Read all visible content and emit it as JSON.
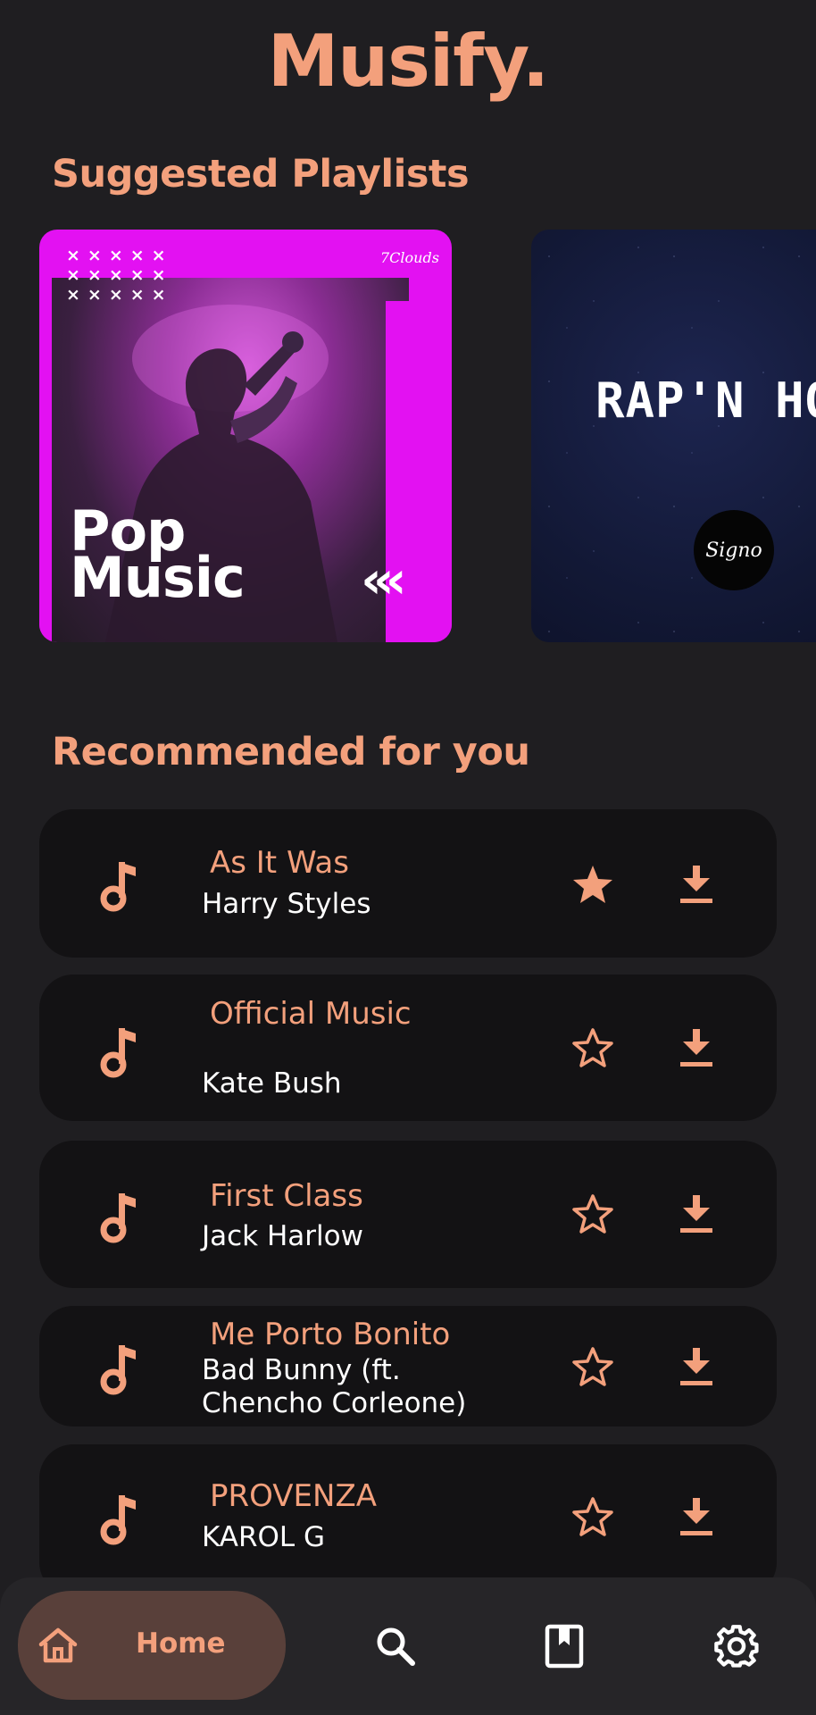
{
  "app": {
    "title": "Musify."
  },
  "sections": {
    "suggested": "Suggested Playlists",
    "recommended": "Recommended for you"
  },
  "playlists": [
    {
      "title_line1": "Pop",
      "title_line2": "Music",
      "logo": "7Clouds",
      "decor_dots": "×××××",
      "decor_arrows": "‹‹‹",
      "accent": "#e311f2"
    },
    {
      "title": "RAP'N HOU",
      "logo": "Signo",
      "accent": "#121835"
    }
  ],
  "songs": [
    {
      "title": "As It Was",
      "artist": "Harry Styles",
      "starred": true
    },
    {
      "title": "Official Music",
      "artist": "Kate Bush",
      "starred": false
    },
    {
      "title": "First Class",
      "artist": "Jack Harlow",
      "starred": false
    },
    {
      "title": "Me Porto Bonito",
      "artist": "Bad Bunny (ft.",
      "artist_line2": "Chencho Corleone)",
      "starred": false
    },
    {
      "title": "PROVENZA",
      "artist": "KAROL G",
      "starred": false
    }
  ],
  "nav": {
    "home_label": "Home",
    "items": [
      "home-icon",
      "search-icon",
      "bookmark-icon",
      "settings-icon"
    ],
    "active": "home"
  },
  "colors": {
    "background": "#1f1e21",
    "accent": "#f3a07c",
    "card": "#131214",
    "nav": "#262528",
    "nav_active": "#59403a"
  }
}
